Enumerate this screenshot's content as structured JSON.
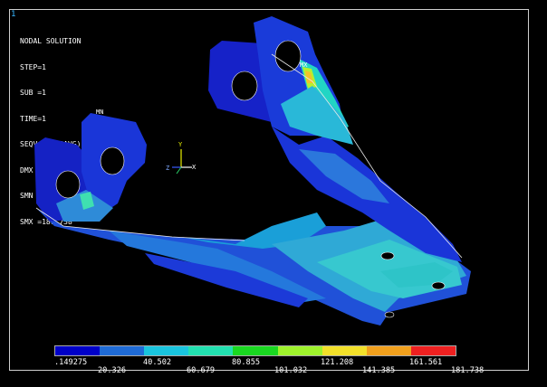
{
  "window_number": "1",
  "info": {
    "title": "NODAL SOLUTION",
    "lines": [
      "STEP=1",
      "SUB =1",
      "TIME=1",
      "SEQV     (AVG)",
      "DMX =1.15",
      "SMN =.149275",
      "SMX =181.738"
    ]
  },
  "markers": {
    "min": "MN",
    "max": "MX"
  },
  "triad": {
    "y": "Y",
    "z": "Z",
    "x": "X"
  },
  "legend": {
    "colors": [
      "#0000c8",
      "#1f6bd6",
      "#19c4de",
      "#22e0b0",
      "#1ad821",
      "#9ef22c",
      "#f2e02a",
      "#f0a01d",
      "#ee2020"
    ],
    "top_labels": [
      ".149275",
      "40.502",
      "80.855",
      "121.208",
      "161.561"
    ],
    "bottom_labels": [
      "20.326",
      "60.679",
      "101.032",
      "141.385",
      "181.738"
    ]
  }
}
